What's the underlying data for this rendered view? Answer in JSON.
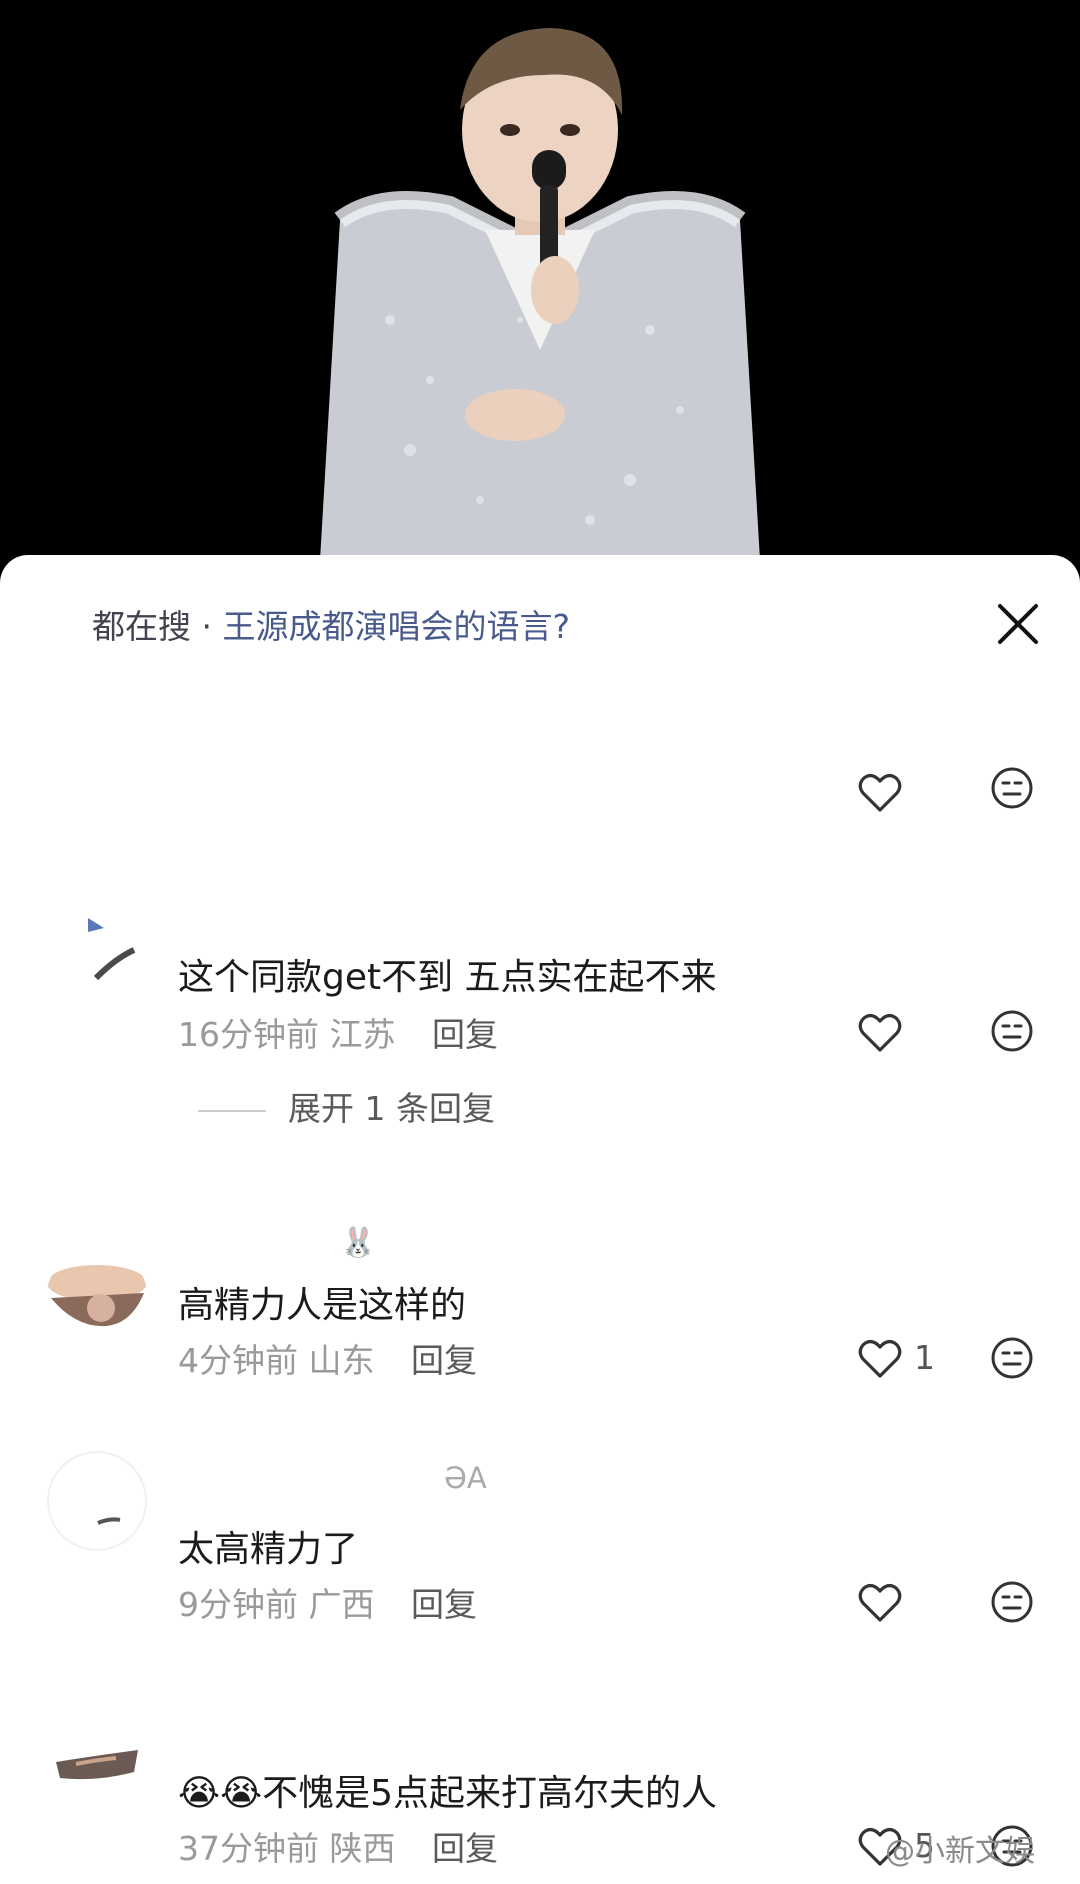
{
  "header": {
    "title_prefix": "都在搜 · ",
    "title_topic": "王源成都演唱会的语言?"
  },
  "icons": {
    "close": "close-icon",
    "like": "heart-outline-icon",
    "dislike": "meh-face-icon"
  },
  "comments": [
    {
      "name": "",
      "text": "这个同款get不到 五点实在起不来",
      "time": "16分钟前",
      "location": "江苏",
      "reply_label": "回复",
      "likes": "",
      "expand_label": "展开 1 条回复"
    },
    {
      "name": "🐰",
      "text": "高精力人是这样的",
      "time": "4分钟前",
      "location": "山东",
      "reply_label": "回复",
      "likes": "1"
    },
    {
      "name": "ƏA",
      "text": "太高精力了",
      "time": "9分钟前",
      "location": "广西",
      "reply_label": "回复",
      "likes": ""
    },
    {
      "name": "",
      "text": "😭😭不愧是5点起来打高尔夫的人",
      "time": "37分钟前",
      "location": "陕西",
      "reply_label": "回复",
      "likes": "5"
    }
  ],
  "watermark": "@小新文娱"
}
